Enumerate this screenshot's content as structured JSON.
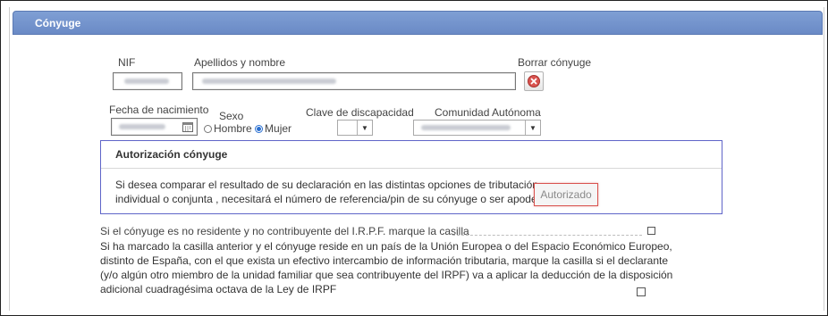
{
  "panel": {
    "title": "Cónyuge"
  },
  "labels": {
    "nif": "NIF",
    "apellidos": "Apellidos y nombre",
    "borrar": "Borrar cónyuge",
    "fecha": "Fecha de nacimiento",
    "sexo": "Sexo",
    "hombre": "Hombre",
    "mujer": "Mujer",
    "clave": "Clave de discapacidad",
    "comunidad": "Comunidad Autónoma"
  },
  "sexo_selected": "Mujer",
  "autorizacion": {
    "title": "Autorización cónyuge",
    "line1": "Si desea comparar el resultado de su declaración en las distintas opciones de tributación,",
    "line2": "individual o conjunta , necesitará el número de referencia/pin de su cónyuge o ser apoderado",
    "button": "Autorizado"
  },
  "no_residente": {
    "text": "Si el cónyuge es no residente y no contribuyente del I.R.P.F. marque la casilla",
    "checked": false
  },
  "deduccion": {
    "line1": "Si ha marcado la casilla anterior y el cónyuge reside en un país de la Unión Europea o del Espacio Económico Europeo,",
    "line2": "distinto de España, con el que exista un efectivo intercambio de información tributaria, marque la casilla si el declarante",
    "line3": "(y/o algún otro miembro de la unidad familiar que sea contribuyente del IRPF) va a aplicar la deducción de la disposición",
    "line4": "adicional cuadragésima octava de la Ley de IRPF",
    "checked": false
  },
  "colors": {
    "header": "#7391cc",
    "auth_border": "#5f65c8",
    "danger": "#d9534f",
    "radio_on": "#2a6fd0"
  }
}
